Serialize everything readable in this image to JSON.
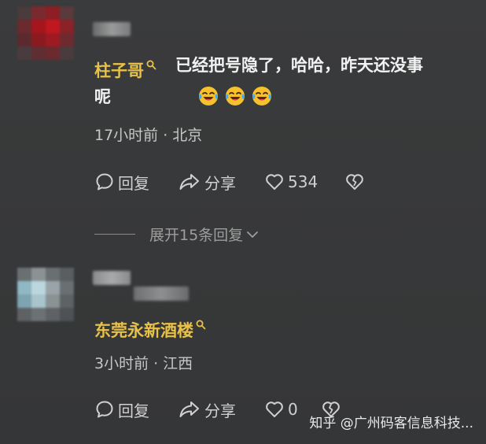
{
  "comments": [
    {
      "username": "柱子哥",
      "text_line1": "已经把号隐了，哈哈，昨天还没事",
      "text_line2": "呢",
      "emojis": [
        "laughing-tears-emoji",
        "laughing-tears-emoji",
        "laughing-tears-emoji"
      ],
      "time": "17小时前",
      "dot": "·",
      "location": "北京",
      "reply_label": "回复",
      "share_label": "分享",
      "like_count": "534",
      "expand_label": "展开15条回复"
    },
    {
      "username": "东莞永新酒楼",
      "time": "3小时前",
      "dot": "·",
      "location": "江西",
      "reply_label": "回复",
      "share_label": "分享",
      "like_count": "0"
    }
  ],
  "watermark": "知乎 @广州码客信息科技...",
  "colors": {
    "username": "#e8c148",
    "background": "#3a3b3c",
    "text": "#f2f2f2",
    "meta": "#c6c6c6"
  }
}
